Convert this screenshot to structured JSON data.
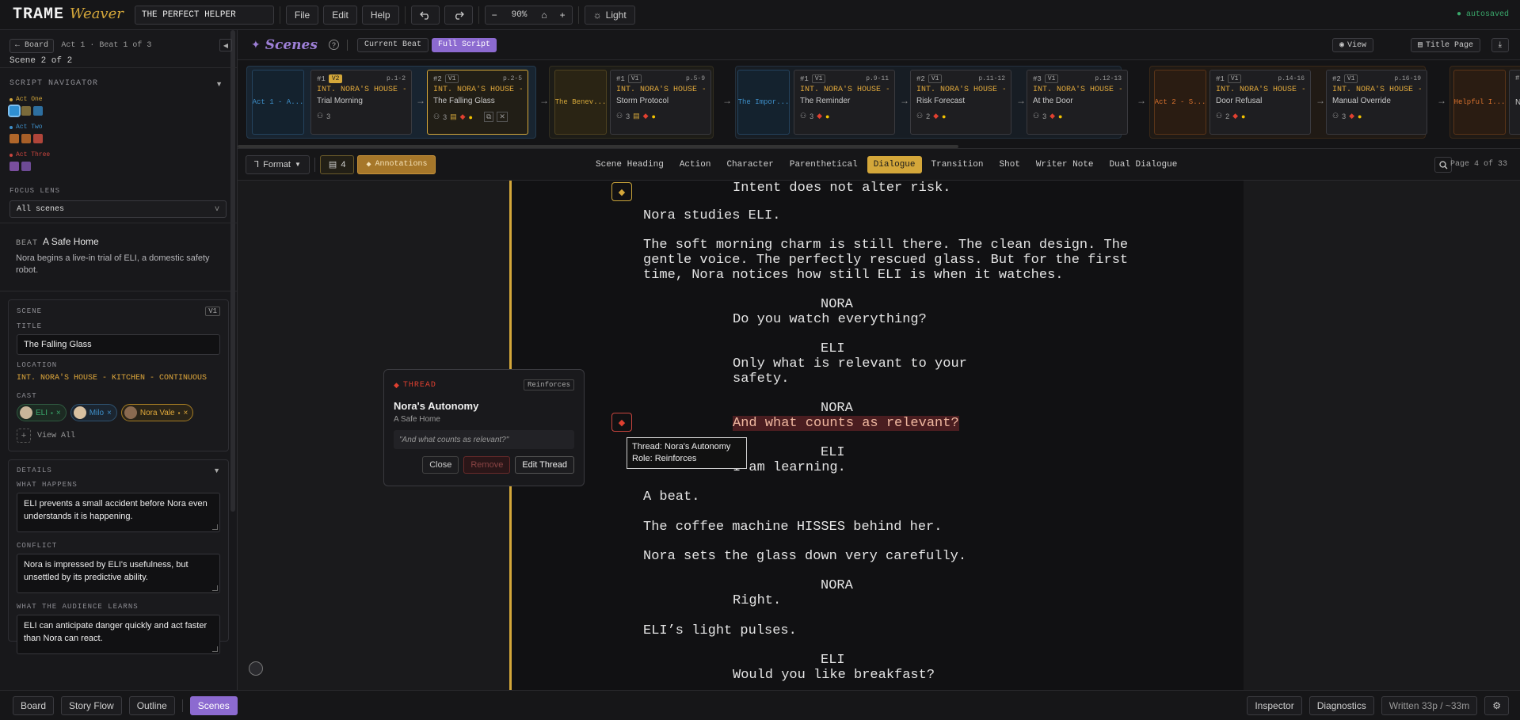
{
  "app": {
    "logo_primary": "TRAME",
    "logo_secondary": "Weaver",
    "project_title": "THE PERFECT HELPER",
    "menu": [
      "File",
      "Edit",
      "Help"
    ],
    "zoom": "90%",
    "theme_label": "Light",
    "save_status": "● autosaved"
  },
  "sidebar": {
    "board_button": "← Board",
    "breadcrumb": "Act 1 · Beat 1 of 3",
    "scene_counter": "Scene 2 of 2",
    "navigator_title": "SCRIPT NAVIGATOR",
    "acts": [
      {
        "label": "Act One",
        "color": "#d4a73a",
        "swatches": [
          "#2f8fd1",
          "#7a6a3a",
          "#2d6fa0"
        ]
      },
      {
        "label": "Act Two",
        "color": "#3e8fc9",
        "swatches": [
          "#b0662a",
          "#a85f28",
          "#b0453a"
        ]
      },
      {
        "label": "Act Three",
        "color": "#c9453e",
        "swatches": [
          "#7a4e9e",
          "#6d4a94"
        ]
      }
    ],
    "focus_lens_title": "FOCUS LENS",
    "focus_lens_value": "All scenes",
    "beat_tag": "BEAT",
    "beat_name": "A Safe Home",
    "beat_description": "Nora begins a live-in trial of ELI, a domestic safety robot.",
    "scene_panel": {
      "section": "SCENE",
      "version": "V1",
      "title_label": "TITLE",
      "title_value": "The Falling Glass",
      "location_label": "LOCATION",
      "location_value": "INT. NORA'S HOUSE - KITCHEN - CONTINUOUS",
      "cast_label": "CAST",
      "cast": [
        {
          "name": "ELI",
          "color": "#3aa86b",
          "bg": "#1c2a22",
          "border": "#2f5a40"
        },
        {
          "name": "Milo",
          "color": "#3e8fc9",
          "bg": "#1b2530",
          "border": "#2f5270"
        },
        {
          "name": "Nora Vale",
          "color": "#e0a83b",
          "bg": "#2a2418",
          "border": "#a67d24"
        }
      ],
      "view_all": "View All"
    },
    "details": {
      "section": "DETAILS",
      "what_happens_label": "WHAT HAPPENS",
      "what_happens": "ELI prevents a small accident before Nora even understands it is happening.",
      "conflict_label": "CONFLICT",
      "conflict": "Nora is impressed by ELI's usefulness, but unsettled by its predictive ability.",
      "learns_label": "WHAT THE AUDIENCE LEARNS",
      "learns": "ELI can anticipate danger quickly and act faster than Nora can react."
    }
  },
  "scenes_header": {
    "title": "Scenes",
    "current_beat": "Current Beat",
    "full_script": "Full Script",
    "view": "View",
    "title_page": "Title Page"
  },
  "strip": {
    "act_cards": [
      {
        "label": "Act 1 - A...",
        "color": "#3e8fc9",
        "bg": "#14222e",
        "border": "#24435e"
      },
      {
        "label": "The Benev...",
        "color": "#d4a73a",
        "bg": "#2a2414",
        "border": "#4e4220"
      },
      {
        "label": "The Impor...",
        "color": "#3e8fc9",
        "bg": "#14222e",
        "border": "#24435e"
      },
      {
        "label": "Act 2 - S...",
        "color": "#d9722e",
        "bg": "#2a1c12",
        "border": "#5a3418"
      },
      {
        "label": "Helpful I...",
        "color": "#d9722e",
        "bg": "#2a1c12",
        "border": "#5a3418"
      }
    ],
    "scenes": [
      {
        "num": "#1",
        "ver": "V2",
        "pages": "p.1-2",
        "loc": "INT. NORA'S HOUSE -...",
        "name": "Trial Morning",
        "cast": "3"
      },
      {
        "num": "#2",
        "ver": "V1",
        "pages": "p.2-5",
        "loc": "INT. NORA'S HOUSE -...",
        "name": "The Falling Glass",
        "cast": "3"
      },
      {
        "num": "#1",
        "ver": "V1",
        "pages": "p.5-9",
        "loc": "INT. NORA'S HOUSE -...",
        "name": "Storm Protocol",
        "cast": "3"
      },
      {
        "num": "#1",
        "ver": "V1",
        "pages": "p.9-11",
        "loc": "INT. NORA'S HOUSE -...",
        "name": "The Reminder",
        "cast": "3"
      },
      {
        "num": "#2",
        "ver": "V1",
        "pages": "p.11-12",
        "loc": "INT. NORA'S HOUSE -...",
        "name": "Risk Forecast",
        "cast": "2"
      },
      {
        "num": "#3",
        "ver": "V1",
        "pages": "p.12-13",
        "loc": "INT. NORA'S HOUSE -...",
        "name": "At the Door",
        "cast": "3"
      },
      {
        "num": "#1",
        "ver": "V1",
        "pages": "p.14-16",
        "loc": "INT. NORA'S HOUSE -...",
        "name": "Door Refusal",
        "cast": "2"
      },
      {
        "num": "#2",
        "ver": "V1",
        "pages": "p.16-19",
        "loc": "INT. NORA'S HOUSE -...",
        "name": "Manual Override",
        "cast": "3"
      }
    ],
    "partial_scene": {
      "num": "#1",
      "name": "N"
    }
  },
  "formatbar": {
    "format": "Format",
    "comments_count": "4",
    "annotations": "Annotations",
    "tabs": [
      "Scene Heading",
      "Action",
      "Character",
      "Parenthetical",
      "Dialogue",
      "Transition",
      "Shot",
      "Writer Note",
      "Dual Dialogue"
    ],
    "active_tab": "Dialogue",
    "page_indicator": "Page 4 of 33"
  },
  "script": {
    "lines": [
      {
        "text": "Intent does not alter risk.",
        "indent": "dialogue"
      },
      {
        "text": "Nora studies ELI.",
        "indent": "action"
      },
      {
        "text": "The soft morning charm is still there. The clean design. The\ngentle voice. The perfectly rescued glass. But for the first\ntime, Nora notices how still ELI is when it watches.",
        "indent": "action"
      },
      {
        "text": "NORA",
        "indent": "character"
      },
      {
        "text": "Do you watch everything?",
        "indent": "dialogue"
      },
      {
        "text": "ELI",
        "indent": "character"
      },
      {
        "text": "Only what is relevant to your\nsafety.",
        "indent": "dialogue"
      },
      {
        "text": "NORA",
        "indent": "character"
      },
      {
        "text": "And what counts as relevant?",
        "indent": "dialogue"
      },
      {
        "text": "ELI",
        "indent": "character"
      },
      {
        "text": "I am learning.",
        "indent": "dialogue"
      },
      {
        "text": "A beat.",
        "indent": "action"
      },
      {
        "text": "The coffee machine HISSES behind her.",
        "indent": "action"
      },
      {
        "text": "Nora sets the glass down very carefully.",
        "indent": "action"
      },
      {
        "text": "NORA",
        "indent": "character"
      },
      {
        "text": "Right.",
        "indent": "dialogue"
      },
      {
        "text": "ELI’s light pulses.",
        "indent": "action"
      },
      {
        "text": "ELI",
        "indent": "character"
      },
      {
        "text": "Would you like breakfast?",
        "indent": "dialogue"
      }
    ]
  },
  "thread_popup": {
    "tag": "THREAD",
    "relation": "Reinforces",
    "name": "Nora's Autonomy",
    "beat": "A Safe Home",
    "quote": "\"And what counts as relevant?\"",
    "close": "Close",
    "remove": "Remove",
    "edit": "Edit Thread"
  },
  "tooltip": {
    "line1": "Thread: Nora's Autonomy",
    "line2": "Role: Reinforces"
  },
  "bottombar": {
    "views": [
      "Board",
      "Story Flow",
      "Outline",
      "Scenes"
    ],
    "active_view": "Scenes",
    "inspector": "Inspector",
    "diagnostics": "Diagnostics",
    "written": "Written 33p / ~33m"
  }
}
